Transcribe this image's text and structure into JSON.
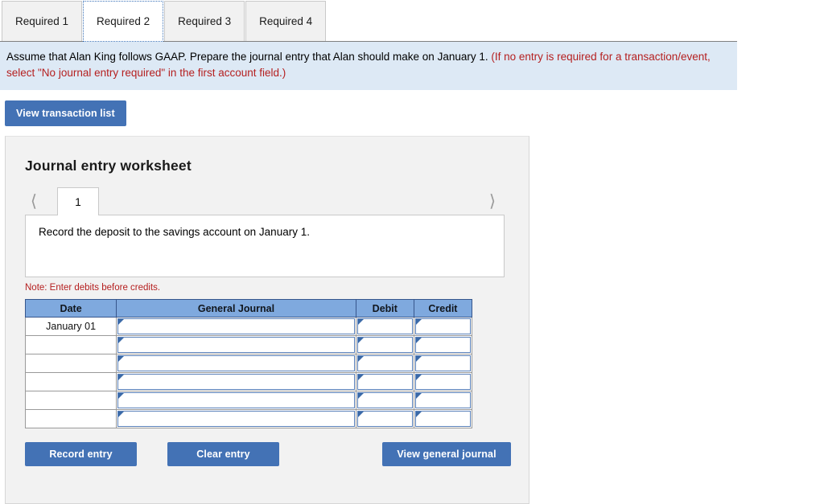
{
  "tabs": [
    {
      "label": "Required 1",
      "active": false
    },
    {
      "label": "Required 2",
      "active": true
    },
    {
      "label": "Required 3",
      "active": false
    },
    {
      "label": "Required 4",
      "active": false
    }
  ],
  "banner": {
    "text_black": "Assume that Alan King follows GAAP. Prepare the journal entry that Alan should make on January 1.",
    "text_red": "(If no entry is required for a transaction/event, select \"No journal entry required\" in the first account field.)"
  },
  "toolbar": {
    "view_transaction_list_label": "View transaction list"
  },
  "worksheet": {
    "title": "Journal entry worksheet",
    "pager": {
      "prev_icon": "chevron-left-icon",
      "next_icon": "chevron-right-icon",
      "current_page": "1"
    },
    "description": "Record the deposit to the savings account on January 1.",
    "note": "Note: Enter debits before credits.",
    "table": {
      "headers": [
        "Date",
        "General Journal",
        "Debit",
        "Credit"
      ],
      "rows": [
        {
          "date": "January 01",
          "general_journal": "",
          "debit": "",
          "credit": ""
        },
        {
          "date": "",
          "general_journal": "",
          "debit": "",
          "credit": ""
        },
        {
          "date": "",
          "general_journal": "",
          "debit": "",
          "credit": ""
        },
        {
          "date": "",
          "general_journal": "",
          "debit": "",
          "credit": ""
        },
        {
          "date": "",
          "general_journal": "",
          "debit": "",
          "credit": ""
        },
        {
          "date": "",
          "general_journal": "",
          "debit": "",
          "credit": ""
        }
      ]
    },
    "actions": {
      "record_entry_label": "Record entry",
      "clear_entry_label": "Clear entry",
      "view_general_journal_label": "View general journal"
    }
  },
  "colors": {
    "button_blue": "#4372b5",
    "table_header_blue": "#7fa9de",
    "banner_background": "#dde9f5",
    "note_red": "#b52020",
    "panel_background": "#f2f2f2",
    "cell_border_blue": "#5a81ba"
  }
}
